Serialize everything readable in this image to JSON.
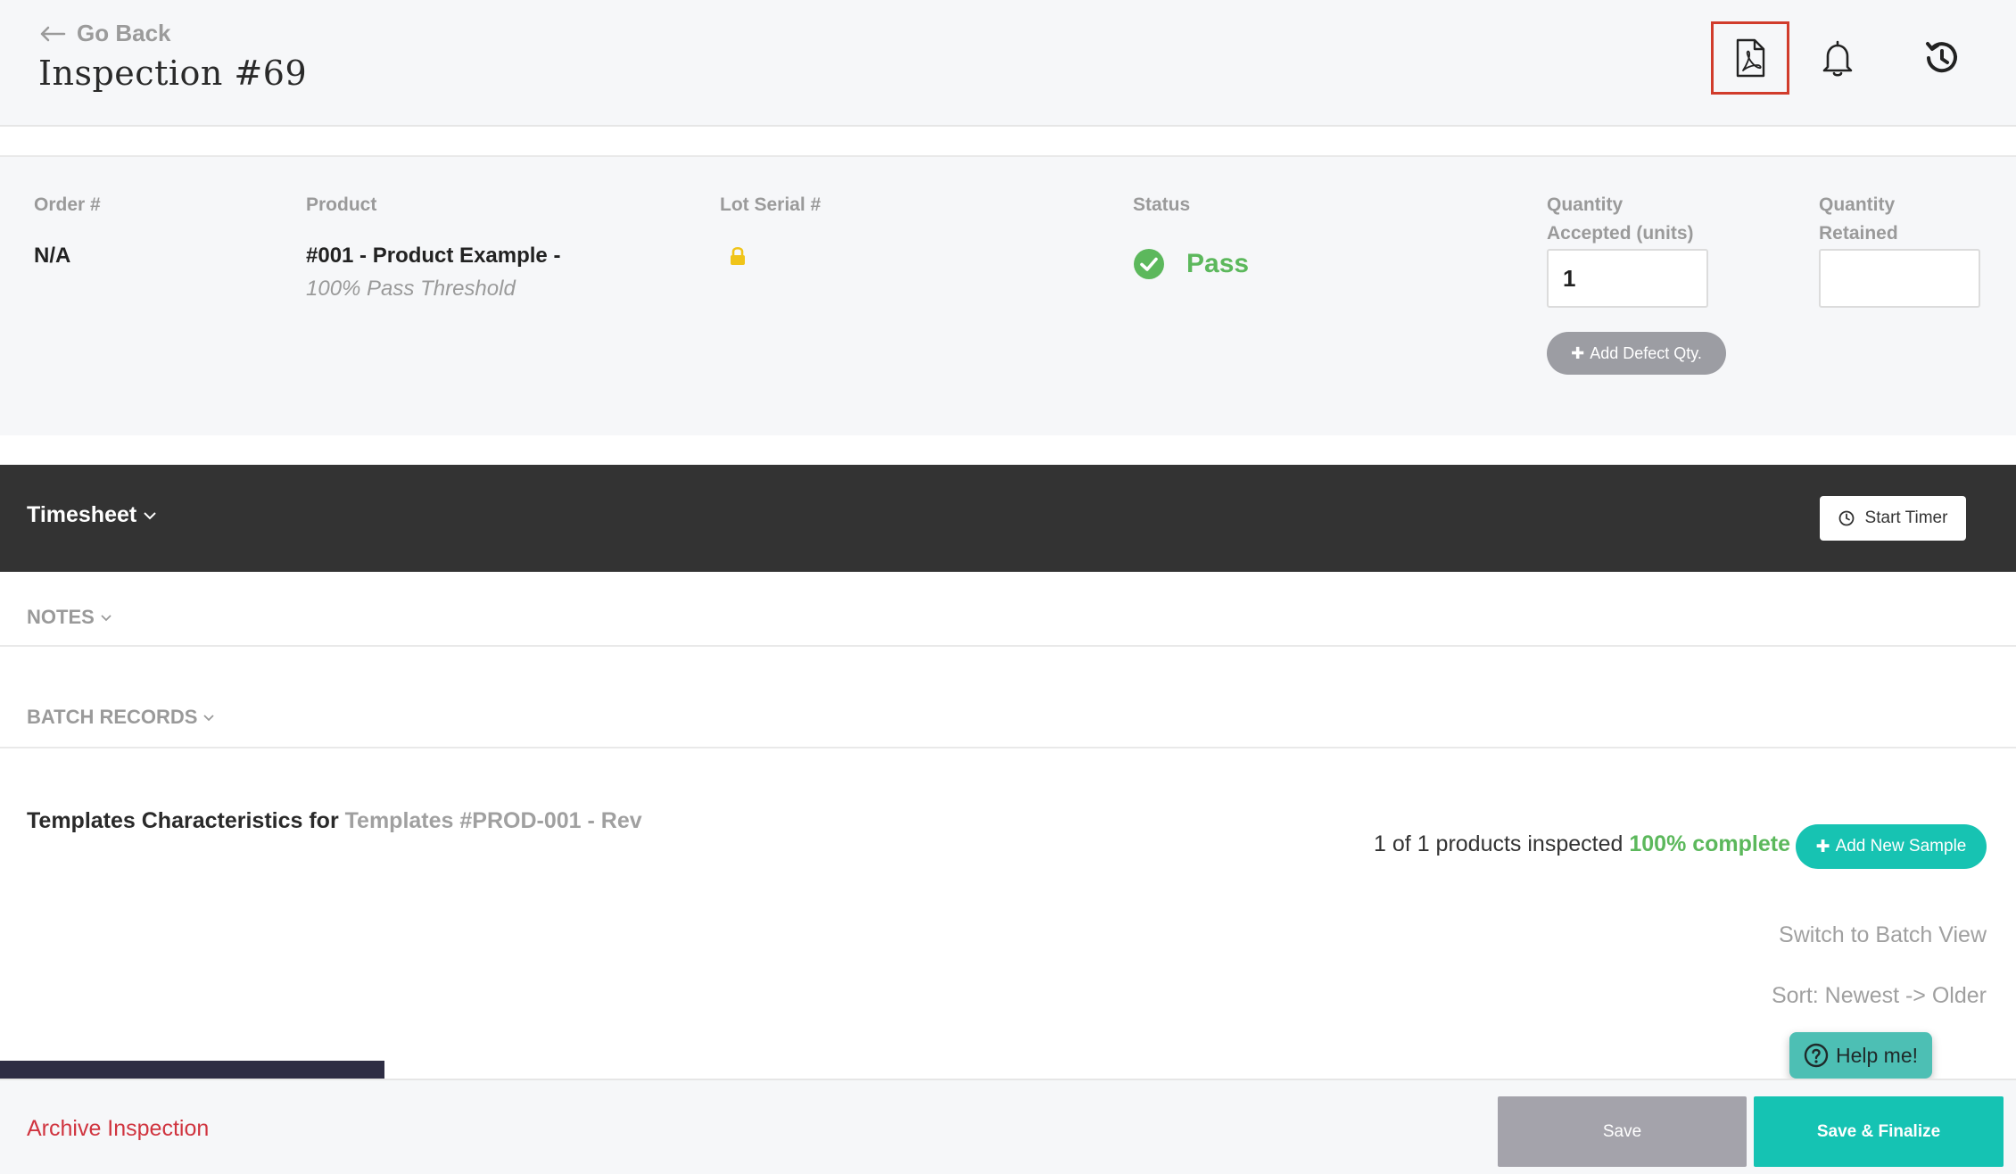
{
  "header": {
    "go_back": "Go Back",
    "title": "Inspection #69",
    "icons": [
      "pdf-icon",
      "bell-icon",
      "history-icon"
    ]
  },
  "info": {
    "order_label": "Order #",
    "order_value": "N/A",
    "product_label": "Product",
    "product_name": "#001 - Product Example -",
    "product_threshold": "100% Pass Threshold",
    "lot_label": "Lot Serial #",
    "status_label": "Status",
    "status_value": "Pass",
    "qty_accepted_label_1": "Quantity",
    "qty_accepted_label_2": "Accepted (units)",
    "qty_accepted_value": "1",
    "qty_retained_label_1": "Quantity",
    "qty_retained_label_2": "Retained",
    "qty_retained_value": "",
    "add_defect": "Add Defect Qty."
  },
  "timesheet": {
    "title": "Timesheet",
    "start_timer": "Start Timer"
  },
  "sections": {
    "notes": "NOTES",
    "batch_records": "BATCH RECORDS"
  },
  "templates": {
    "title_prefix": "Templates Characteristics for",
    "title_ref": "Templates #PROD-001 - Rev",
    "inspected_text": "1 of 1 products inspected",
    "complete_text": "100% complete",
    "add_sample": "Add New Sample",
    "switch_view": "Switch to Batch View",
    "sort": "Sort: Newest -> Older"
  },
  "help": "Help me!",
  "footer": {
    "archive": "Archive Inspection",
    "save": "Save",
    "finalize": "Save & Finalize"
  },
  "colors": {
    "accent_teal": "#15c3b3",
    "pass_green": "#5cb85c",
    "archive_red": "#d0343f",
    "pdf_highlight": "#d13c2c",
    "timesheet_bg": "#333333"
  }
}
